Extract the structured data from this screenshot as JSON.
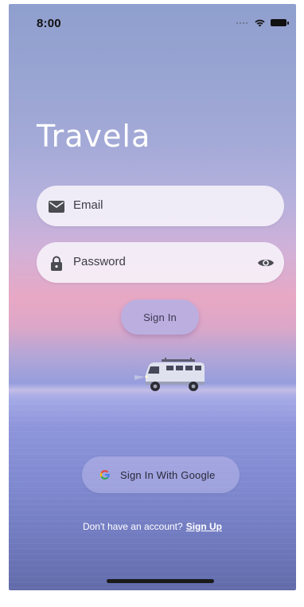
{
  "status_bar": {
    "time": "8:00"
  },
  "app": {
    "title": "Travela"
  },
  "form": {
    "email_placeholder": "Email",
    "password_placeholder": "Password",
    "sign_in_label": "Sign In"
  },
  "google": {
    "label": "Sign In With Google"
  },
  "footer": {
    "prompt": "Don't have an account?",
    "signup_label": "Sign Up"
  },
  "icons": {
    "email": "envelope-icon",
    "password": "lock-icon",
    "visibility": "eye-icon",
    "google": "google-icon"
  },
  "colors": {
    "field_bg": "#f7f4fa",
    "button_bg": "#b9b0e2",
    "title": "#ffffff"
  }
}
